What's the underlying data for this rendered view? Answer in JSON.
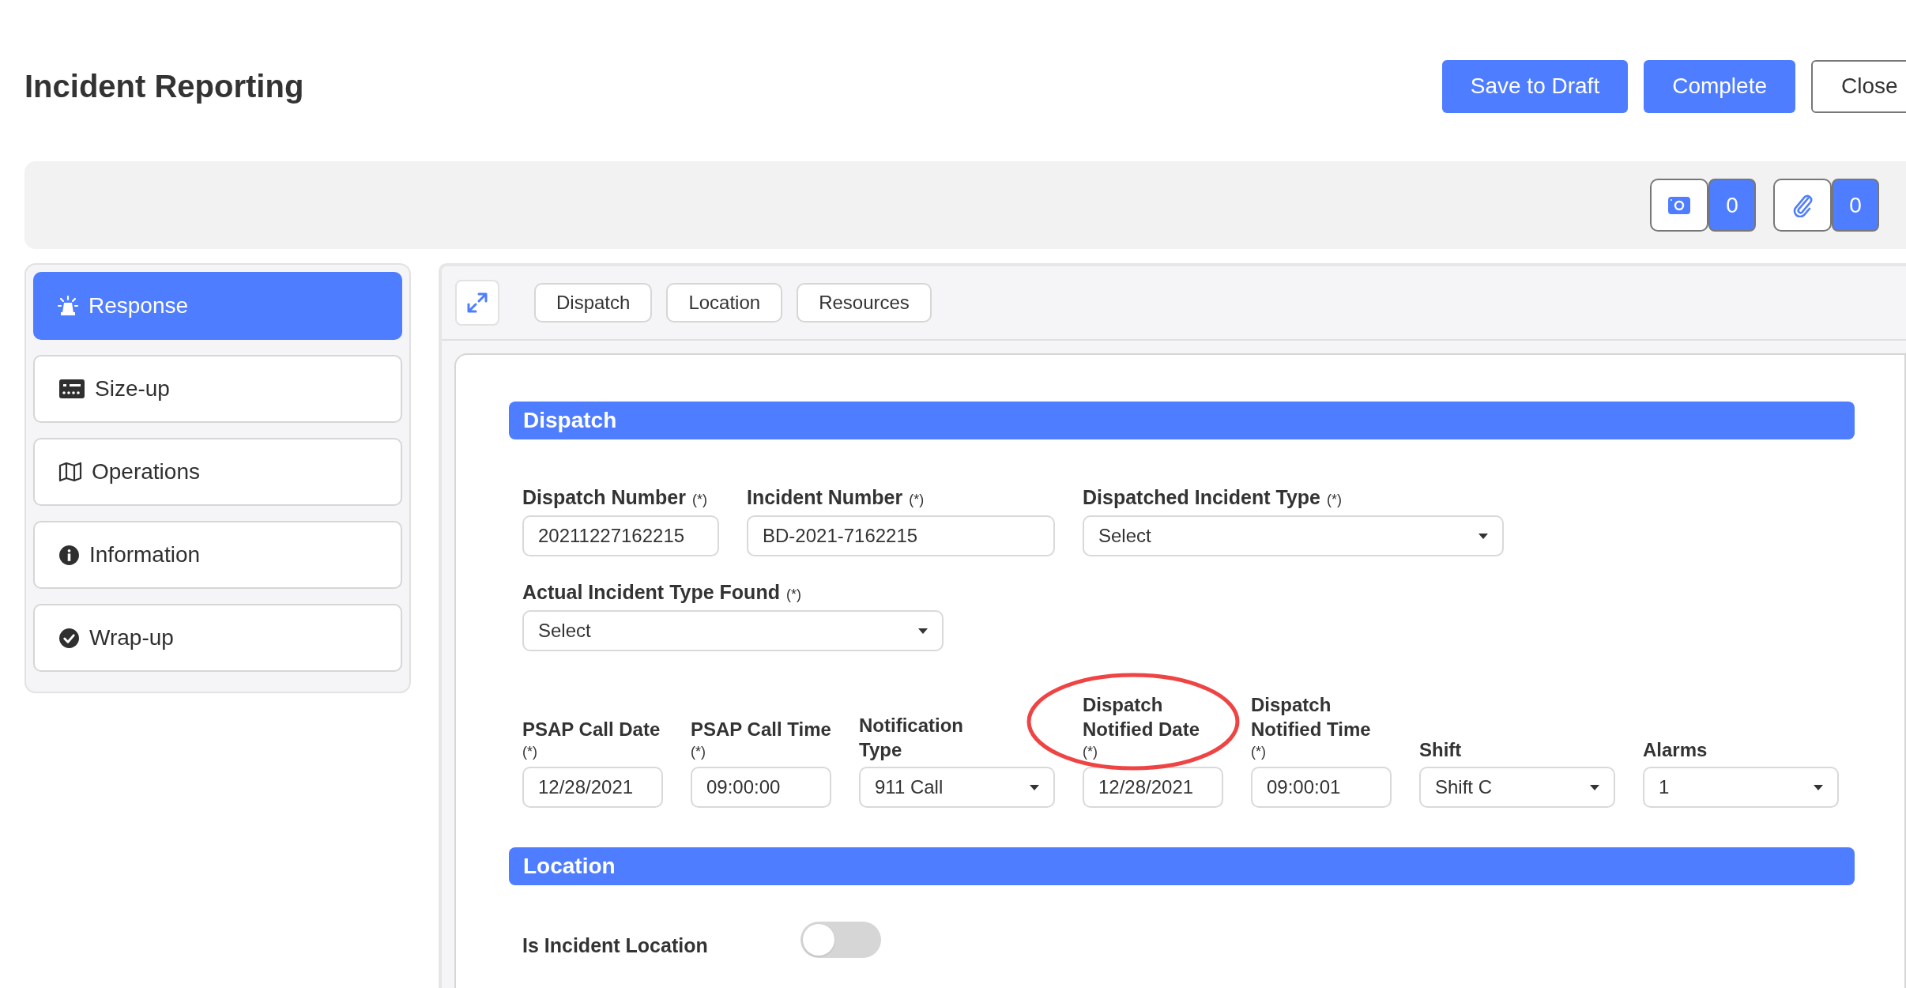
{
  "page": {
    "title": "Incident Reporting"
  },
  "actions": [
    {
      "label": "Save to Draft",
      "kind": "primary"
    },
    {
      "label": "Complete",
      "kind": "primary"
    },
    {
      "label": "Close",
      "kind": "outline"
    }
  ],
  "counters": [
    {
      "count": "0"
    },
    {
      "count": "0"
    }
  ],
  "sidebar": {
    "items": [
      {
        "label": "Response",
        "selected": true
      },
      {
        "label": "Size-up",
        "selected": false
      },
      {
        "label": "Operations",
        "selected": false
      },
      {
        "label": "Information",
        "selected": false
      },
      {
        "label": "Wrap-up",
        "selected": false
      }
    ]
  },
  "tabs": [
    {
      "label": "Dispatch"
    },
    {
      "label": "Location"
    },
    {
      "label": "Resources"
    }
  ],
  "sections": [
    {
      "title": "Dispatch",
      "field_lines": [
        [
          {
            "kind": "text",
            "label": "Dispatch Number",
            "required": "(*)",
            "value": "20211227162215",
            "highlighted": false
          },
          {
            "kind": "text",
            "label": "Incident Number",
            "required": "(*)",
            "value": "BD-2021-7162215",
            "highlighted": false
          },
          {
            "kind": "select",
            "label": "Dispatched Incident Type",
            "required": "(*)",
            "value": "Select",
            "highlighted": false
          }
        ],
        [
          {
            "kind": "select",
            "label": "Actual Incident Type Found",
            "required": "(*)",
            "value": "Select",
            "highlighted": false
          }
        ],
        [
          {
            "kind": "text",
            "label": "PSAP Call Date",
            "required": "(*)",
            "value": "12/28/2021",
            "highlighted": false
          },
          {
            "kind": "text",
            "label": "PSAP Call Time",
            "required": "(*)",
            "value": "09:00:00",
            "highlighted": false
          },
          {
            "kind": "select",
            "label": "Notification Type",
            "value": "911 Call",
            "highlighted": false
          },
          {
            "kind": "text",
            "label": "Dispatch Notified Date",
            "required": "(*)",
            "value": "12/28/2021",
            "highlighted": true
          },
          {
            "kind": "text",
            "label": "Dispatch Notified Time",
            "required": "(*)",
            "value": "09:00:01",
            "highlighted": false
          },
          {
            "kind": "select",
            "label": "Shift",
            "value": "Shift C",
            "highlighted": false
          },
          {
            "kind": "select",
            "label": "Alarms",
            "value": "1",
            "highlighted": false
          }
        ]
      ]
    },
    {
      "title": "Location",
      "field_lines": [
        [
          {
            "kind": "toggle",
            "label": "Is Incident Location",
            "on": false
          }
        ]
      ]
    }
  ]
}
